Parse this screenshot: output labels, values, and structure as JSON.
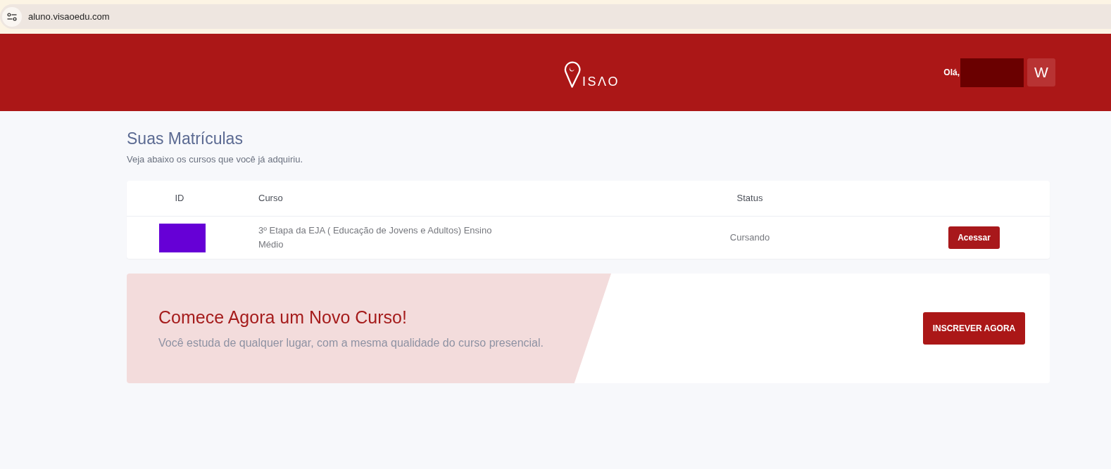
{
  "browser": {
    "url": "aluno.visaoedu.com"
  },
  "header": {
    "logo_text": "ISΛO",
    "greeting": "Olá,",
    "avatar_initial": "W"
  },
  "page": {
    "title": "Suas Matrículas",
    "subtitle": "Veja abaixo os cursos que você já adquiriu."
  },
  "table": {
    "columns": [
      "ID",
      "Curso",
      "Status"
    ],
    "rows": [
      {
        "course": "3º Etapa da EJA ( Educação de Jovens e Adultos) Ensino Médio",
        "status": "Cursando",
        "action": "Acessar"
      }
    ]
  },
  "banner": {
    "title": "Comece Agora um Novo Curso!",
    "text": "Você estuda de qualquer lugar, com a mesma qualidade do curso presencial.",
    "button": "INSCREVER AGORA"
  }
}
